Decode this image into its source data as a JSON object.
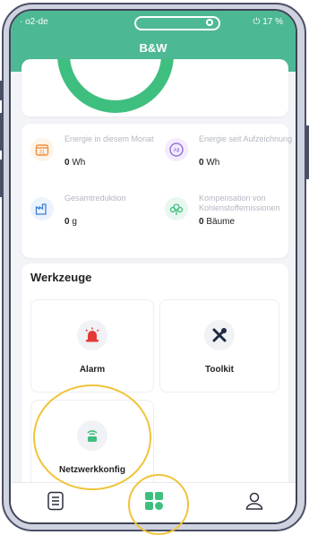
{
  "status": {
    "carrier": "· o2-de",
    "battery": "17 %"
  },
  "header": {
    "title": "B&W"
  },
  "stats": [
    {
      "label": "Energie in diesem Monat",
      "value": "0",
      "unit": "Wh",
      "icon": "calendar-icon",
      "color": "#f08c3a"
    },
    {
      "label": "Energie seit Aufzeichnung",
      "value": "0",
      "unit": "Wh",
      "icon": "all-icon",
      "color": "#8a63d2"
    },
    {
      "label": "Gesamtreduktion",
      "value": "0",
      "unit": "g",
      "icon": "factory-icon",
      "color": "#3f7fd6"
    },
    {
      "label": "Kompensation von Kohlenstoffemissionen",
      "value": "0",
      "unit": "Bäume",
      "icon": "tree-icon",
      "color": "#3fbf7f"
    }
  ],
  "tools": {
    "section_title": "Werkzeuge",
    "items": [
      {
        "label": "Alarm",
        "icon": "alarm-icon",
        "color": "#e53935"
      },
      {
        "label": "Toolkit",
        "icon": "tools-icon",
        "color": "#1f2a44"
      },
      {
        "label": "Netzwerkkonfig",
        "icon": "wifi-router-icon",
        "color": "#3fbf7f"
      }
    ]
  },
  "tabbar": {
    "items": [
      {
        "name": "list-icon"
      },
      {
        "name": "dashboard-icon",
        "active": true
      },
      {
        "name": "profile-icon"
      }
    ]
  },
  "colors": {
    "brand": "#4db894",
    "highlight": "#f0c43a"
  }
}
